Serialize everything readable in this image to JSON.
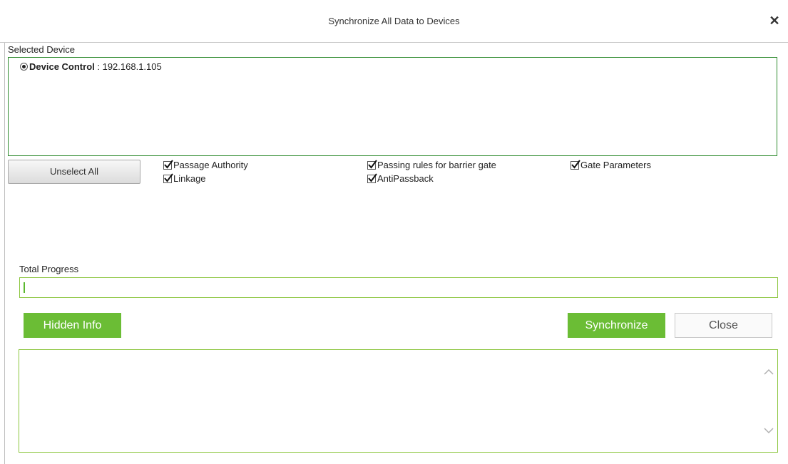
{
  "dialog": {
    "title": "Synchronize All Data to Devices",
    "close_icon": "close-icon"
  },
  "selected_device": {
    "label": "Selected Device",
    "device": {
      "name": "Device Control",
      "separator": " : ",
      "ip": "192.168.1.105",
      "selected": true
    }
  },
  "buttons": {
    "unselect_all": "Unselect All",
    "hidden_info": "Hidden Info",
    "synchronize": "Synchronize",
    "close": "Close"
  },
  "options": [
    {
      "label": "Passage Authority",
      "checked": true
    },
    {
      "label": "Passing rules for barrier gate",
      "checked": true
    },
    {
      "label": "Gate Parameters",
      "checked": true
    },
    {
      "label": "Linkage",
      "checked": true
    },
    {
      "label": "AntiPassback",
      "checked": true
    }
  ],
  "progress": {
    "label": "Total Progress",
    "value_percent": 0
  },
  "colors": {
    "accent_green": "#6bbd35",
    "border_green": "#8cc63f",
    "device_box_border": "#2e8b2e"
  }
}
